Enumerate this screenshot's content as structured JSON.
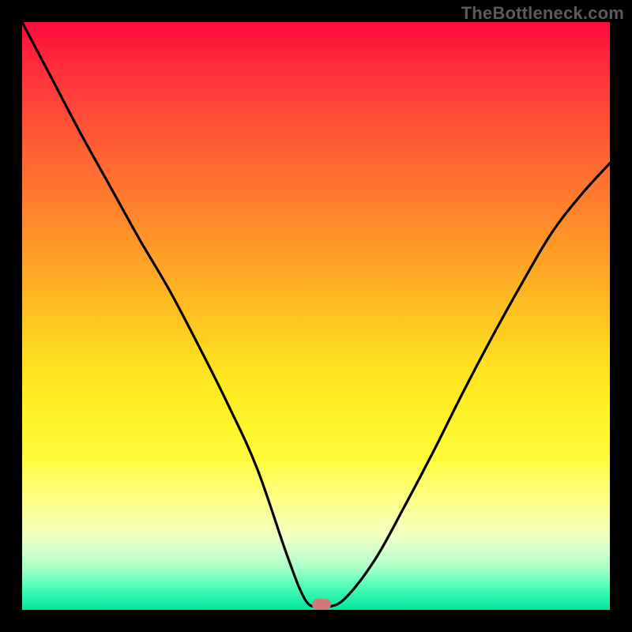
{
  "watermark": "TheBottleneck.com",
  "chart_data": {
    "type": "line",
    "title": "",
    "xlabel": "",
    "ylabel": "",
    "xlim": [
      0,
      1
    ],
    "ylim": [
      0,
      1
    ],
    "grid": false,
    "legend": false,
    "series": [
      {
        "name": "curve",
        "x": [
          0.0,
          0.05,
          0.1,
          0.15,
          0.2,
          0.25,
          0.3,
          0.35,
          0.4,
          0.45,
          0.48,
          0.5,
          0.52,
          0.55,
          0.6,
          0.65,
          0.7,
          0.75,
          0.8,
          0.85,
          0.9,
          0.95,
          1.0
        ],
        "y": [
          1.0,
          0.905,
          0.81,
          0.72,
          0.63,
          0.545,
          0.45,
          0.35,
          0.24,
          0.095,
          0.02,
          0.005,
          0.005,
          0.02,
          0.085,
          0.175,
          0.27,
          0.37,
          0.465,
          0.555,
          0.64,
          0.705,
          0.76
        ]
      }
    ],
    "marker": {
      "x": 0.51,
      "y": 0.009
    },
    "colors": {
      "curve": "#000000",
      "marker": "#d17b77",
      "gradient_top": "#ff0a3b",
      "gradient_bottom": "#00e59f"
    }
  }
}
